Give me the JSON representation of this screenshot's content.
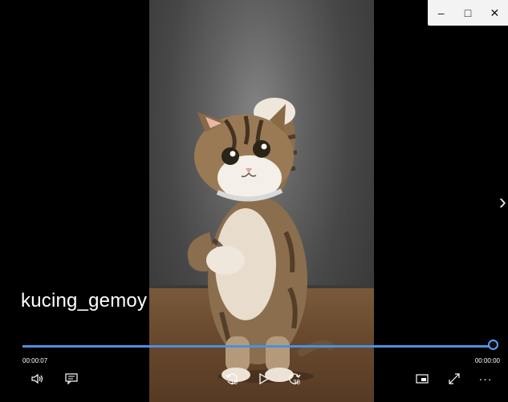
{
  "window": {
    "minimize": "–",
    "maximize": "□",
    "close": "✕"
  },
  "video": {
    "title": "kucing_gemoy",
    "elapsed": "00:00:07",
    "remaining": "00:00:00",
    "progress": 1.0
  },
  "controls": {
    "skip_back_seconds": "10",
    "skip_forward_seconds": "30",
    "more": "···"
  },
  "colors": {
    "accent": "#4a90e2",
    "background": "#000000"
  },
  "icons": [
    "volume-icon",
    "captions-icon",
    "skip-back-icon",
    "play-icon",
    "skip-forward-icon",
    "mini-player-icon",
    "fullscreen-icon",
    "more-icon",
    "next-icon"
  ]
}
